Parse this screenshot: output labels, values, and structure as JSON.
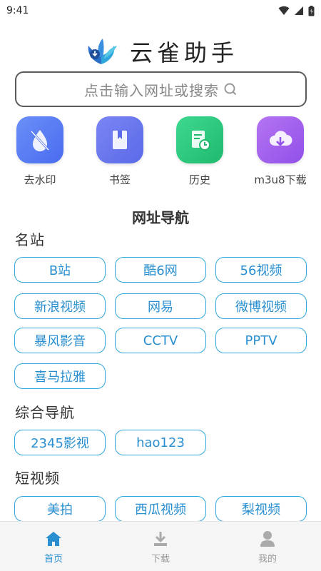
{
  "status": {
    "time": "9:41"
  },
  "brand": {
    "title": "云雀助手"
  },
  "search": {
    "placeholder": "点击输入网址或搜索"
  },
  "tools": [
    {
      "label": "去水印",
      "icon": "watermark-remove-icon",
      "color": "#5b7cf5"
    },
    {
      "label": "书签",
      "icon": "bookmark-icon",
      "color": "#6c7cf0"
    },
    {
      "label": "历史",
      "icon": "history-icon",
      "color": "#2fcf86"
    },
    {
      "label": "m3u8下载",
      "icon": "cloud-download-icon",
      "color": "#a860ee"
    }
  ],
  "nav": {
    "title": "网址导航"
  },
  "sections": [
    {
      "title": "名站",
      "links": [
        "B站",
        "酷6网",
        "56视频",
        "新浪视频",
        "网易",
        "微博视频",
        "暴风影音",
        "CCTV",
        "PPTV",
        "喜马拉雅"
      ]
    },
    {
      "title": "综合导航",
      "links": [
        "2345影视",
        "hao123"
      ]
    },
    {
      "title": "短视频",
      "links": [
        "美拍",
        "西瓜视频",
        "梨视频"
      ]
    }
  ],
  "tabs": [
    {
      "label": "首页",
      "icon": "home-icon",
      "active": true
    },
    {
      "label": "下载",
      "icon": "download-icon",
      "active": false
    },
    {
      "label": "我的",
      "icon": "user-icon",
      "active": false
    }
  ],
  "colors": {
    "accent": "#2a8fd0",
    "chip_border": "#2fa7dc"
  }
}
